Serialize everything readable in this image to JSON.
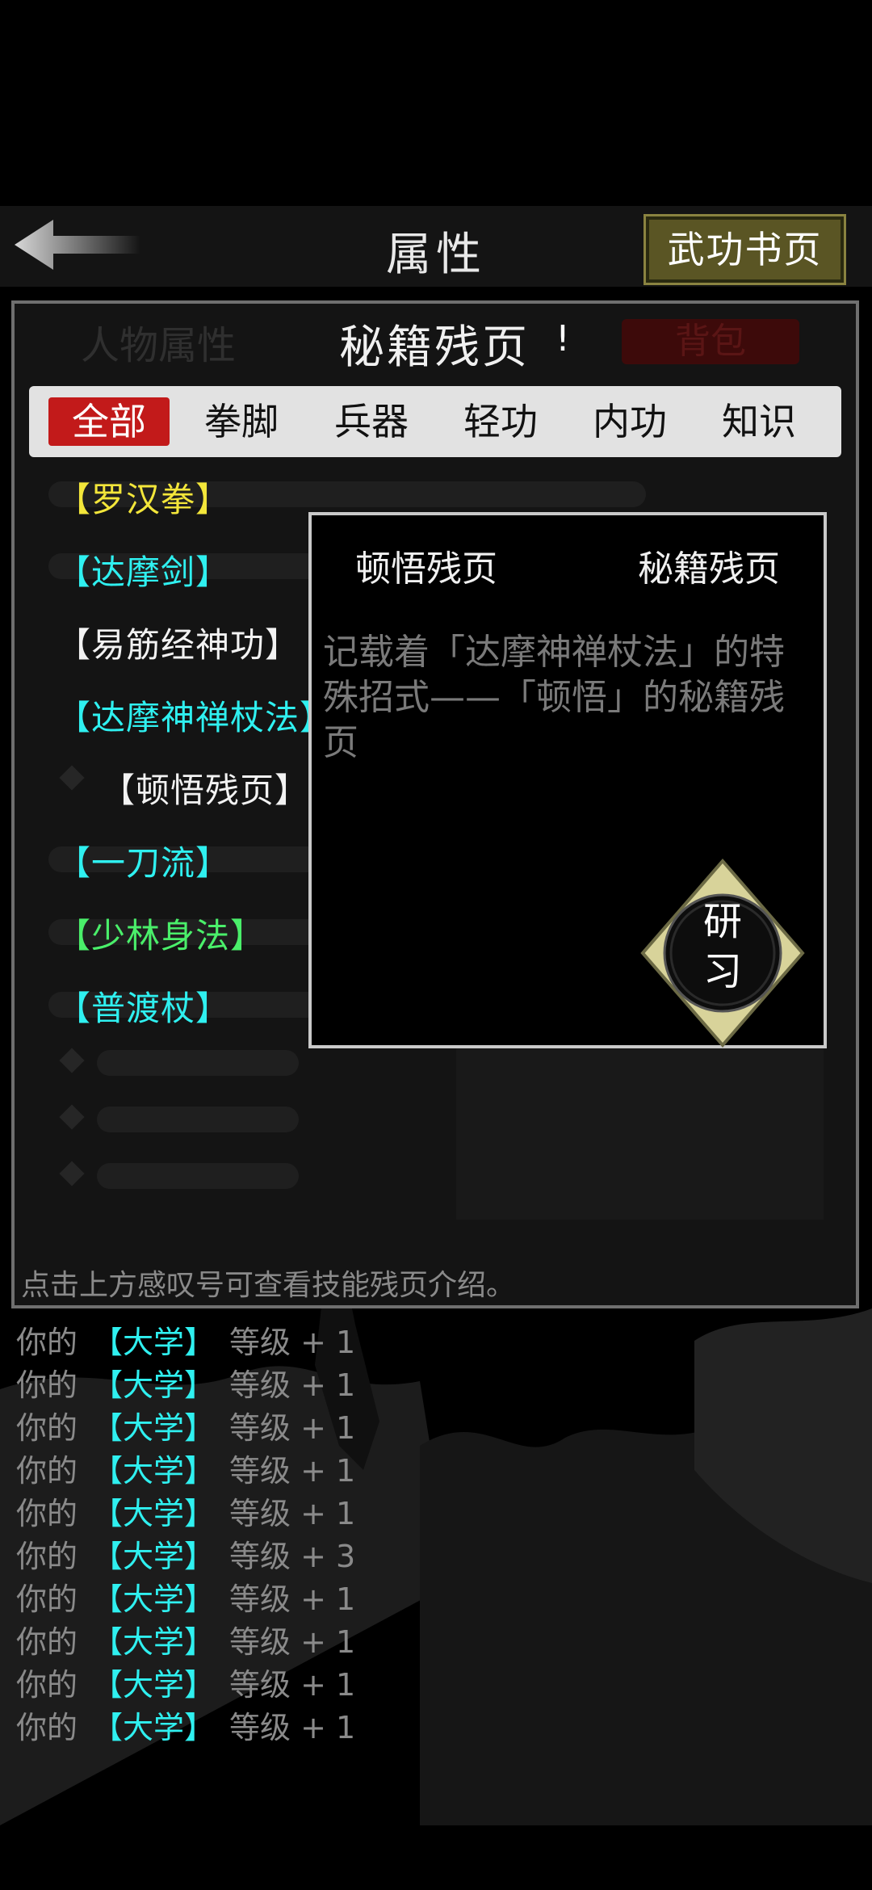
{
  "header": {
    "title": "属性",
    "wugong_button": "武功书页"
  },
  "panel": {
    "page_title": "秘籍残页",
    "info_mark": "!",
    "attr_tab": "人物属性",
    "bag_tab": "背包",
    "tabs": [
      "全部",
      "拳脚",
      "兵器",
      "轻功",
      "内功",
      "知识"
    ],
    "active_tab": "全部",
    "skills": [
      {
        "label": "【罗汉拳】",
        "color": "#f3e63a"
      },
      {
        "label": "【达摩剑】",
        "color": "#2ff0f0"
      },
      {
        "label": "【易筋经神功】",
        "color": "#f2f2f2"
      },
      {
        "label": "【达摩神禅杖法】",
        "color": "#2ff0f0"
      },
      {
        "label": "【顿悟残页】",
        "color": "#f2f2f2"
      },
      {
        "label": "【一刀流】",
        "color": "#2ff0f0"
      },
      {
        "label": "【少林身法】",
        "color": "#4aef6a"
      },
      {
        "label": "【普渡杖】",
        "color": "#2ff0f0"
      }
    ],
    "hint": "点击上方感叹号可查看技能残页介绍。"
  },
  "popup": {
    "left_title": "顿悟残页",
    "right_title": "秘籍残页",
    "description": "记载着「达摩神禅杖法」的特殊招式——「顿悟」的秘籍残页",
    "study_button": "研\n习"
  },
  "log": [
    {
      "prefix": "你的",
      "name": "【大学】",
      "suffix": "等级 + 1"
    },
    {
      "prefix": "你的",
      "name": "【大学】",
      "suffix": "等级 + 1"
    },
    {
      "prefix": "你的",
      "name": "【大学】",
      "suffix": "等级 + 1"
    },
    {
      "prefix": "你的",
      "name": "【大学】",
      "suffix": "等级 + 1"
    },
    {
      "prefix": "你的",
      "name": "【大学】",
      "suffix": "等级 + 1"
    },
    {
      "prefix": "你的",
      "name": "【大学】",
      "suffix": "等级 + 3"
    },
    {
      "prefix": "你的",
      "name": "【大学】",
      "suffix": "等级 + 1"
    },
    {
      "prefix": "你的",
      "name": "【大学】",
      "suffix": "等级 + 1"
    },
    {
      "prefix": "你的",
      "name": "【大学】",
      "suffix": "等级 + 1"
    },
    {
      "prefix": "你的",
      "name": "【大学】",
      "suffix": "等级 + 1"
    }
  ],
  "colors": {
    "accent_red": "#c21a1a",
    "cyan": "#2ff0f0",
    "yellow": "#f3e63a",
    "green": "#4aef6a",
    "button_olive": "#5a5524"
  }
}
